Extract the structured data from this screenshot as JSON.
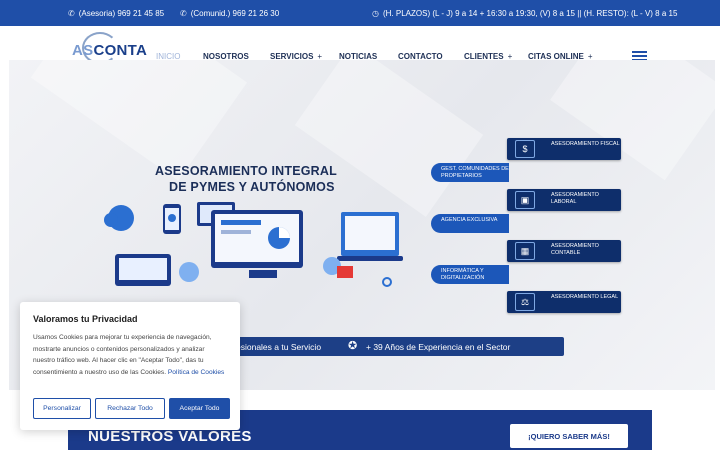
{
  "topbar": {
    "phone_asesoria": "(Asesoria) 969 21 45 85",
    "phone_comunid": "(Comunid.) 969 21 26 30",
    "hours": "(H. PLAZOS) (L - J) 9 a 14 + 16:30 a 19:30, (V) 8 a 15 || (H. RESTO): (L - V) 8 a 15"
  },
  "logo": {
    "as": "AS",
    "conta": "CONTA"
  },
  "nav": {
    "inicio": "INICIO",
    "nosotros": "NOSOTROS",
    "servicios": "SERVICIOS",
    "noticias": "NOTICIAS",
    "contacto": "CONTACTO",
    "clientes": "CLIENTES",
    "citas": "CITAS ONLINE",
    "plus": "+"
  },
  "hero": {
    "headline_1": "ASESORAMIENTO INTEGRAL",
    "headline_2": "DE PYMES Y AUTÓNOMOS",
    "services_right": [
      "ASESORAMIENTO FISCAL",
      "ASESORAMIENTO LABORAL",
      "ASESORAMIENTO CONTABLE",
      "ASESORAMIENTO LEGAL"
    ],
    "services_left": [
      "GEST. COMUNIDADES DE PROPIETARIOS",
      "AGENCIA EXCLUSIVA",
      "INFORMÁTICA Y DIGITALIZACIÓN"
    ],
    "banner_left": "esionales a tu Servicio",
    "banner_right": "+ 39 Años de Experiencia en el Sector"
  },
  "cookie": {
    "title": "Valoramos tu Privacidad",
    "text": "Usamos Cookies para mejorar tu experiencia de navegación, mostrarte anuncios o contenidos personalizados y analizar nuestro tráfico web. Al hacer clic en \"Aceptar Todo\", das tu consentimiento a nuestro uso de las Cookies.",
    "policy_link": "Política de Cookies",
    "btn_personalizar": "Personalizar",
    "btn_rechazar": "Rechazar Todo",
    "btn_aceptar": "Aceptar Todo"
  },
  "valores": {
    "title": "NUESTROS VALORES",
    "cta": "¡QUIERO SABER MÁS!"
  },
  "colors": {
    "primary": "#1f4fa8",
    "dark": "#1b3a8a",
    "navy": "#0e2e6b"
  }
}
